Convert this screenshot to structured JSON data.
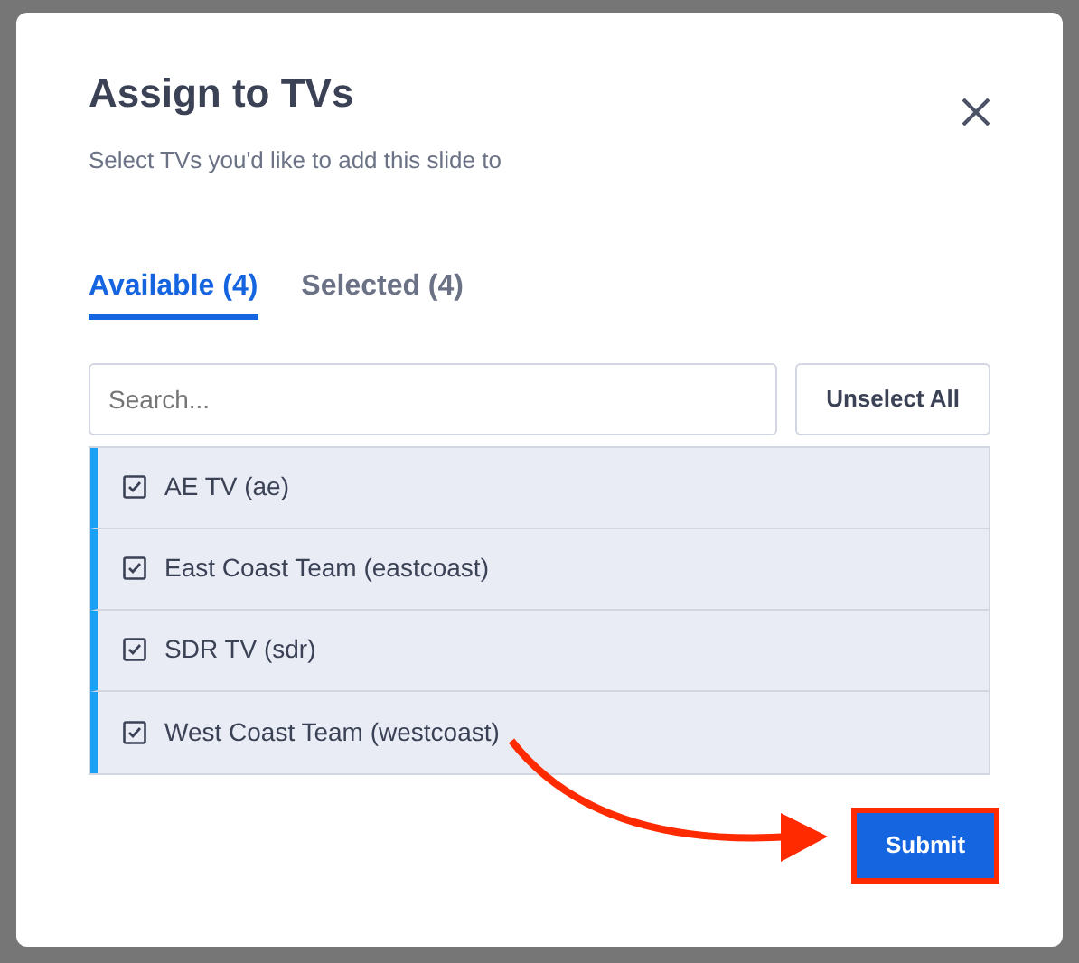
{
  "dialog": {
    "title": "Assign to TVs",
    "subtitle": "Select TVs you'd like to add this slide to"
  },
  "tabs": [
    {
      "label": "Available (4)",
      "selected": true
    },
    {
      "label": "Selected (4)",
      "selected": false
    }
  ],
  "search": {
    "placeholder": "Search..."
  },
  "unselect_all": "Unselect All",
  "tvs": [
    {
      "label": "AE TV (ae)",
      "checked": true,
      "selected": true
    },
    {
      "label": "East Coast Team (eastcoast)",
      "checked": true,
      "selected": true
    },
    {
      "label": "SDR TV (sdr)",
      "checked": true,
      "selected": true
    },
    {
      "label": "West Coast Team (westcoast)",
      "checked": true,
      "selected": true
    }
  ],
  "submit": {
    "label": "Submit",
    "highlighted": true
  }
}
